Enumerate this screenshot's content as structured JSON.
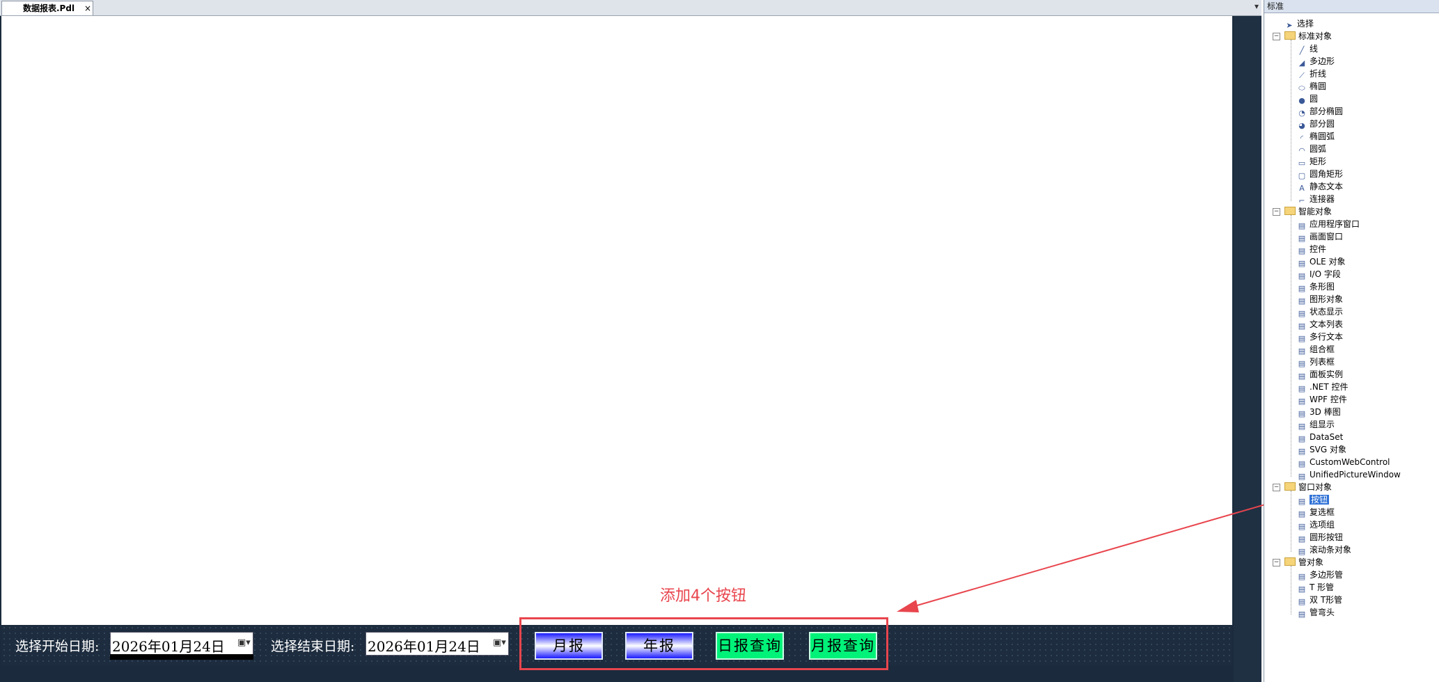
{
  "editor": {
    "tab": {
      "label": "数据报表.Pdl",
      "close": "×"
    },
    "tab_dropdown": "▾"
  },
  "controls": {
    "start_label": "选择开始日期:",
    "start_value": "2026年01月24日",
    "end_label": "选择结束日期:",
    "end_value": "2026年01月24日",
    "buttons": [
      {
        "label": "月报"
      },
      {
        "label": "年报"
      },
      {
        "label": "日报查询"
      },
      {
        "label": "月报查询"
      }
    ]
  },
  "annotation": {
    "text": "添加4个按钮",
    "color": "#e8454d"
  },
  "panel": {
    "title": "标准",
    "select": "选择",
    "groups": [
      {
        "name": "标准对象",
        "items": [
          "线",
          "多边形",
          "折线",
          "椭圆",
          "圆",
          "部分椭圆",
          "部分圆",
          "椭圆弧",
          "圆弧",
          "矩形",
          "圆角矩形",
          "静态文本",
          "连接器"
        ]
      },
      {
        "name": "智能对象",
        "items": [
          "应用程序窗口",
          "画面窗口",
          "控件",
          "OLE 对象",
          "I/O 字段",
          "条形图",
          "图形对象",
          "状态显示",
          "文本列表",
          "多行文本",
          "组合框",
          "列表框",
          "面板实例",
          ".NET 控件",
          "WPF 控件",
          "3D 棒图",
          "组显示",
          "DataSet",
          "SVG 对象",
          "CustomWebControl",
          "UnifiedPictureWindow"
        ]
      },
      {
        "name": "窗口对象",
        "items": [
          "按钮",
          "复选框",
          "选项组",
          "圆形按钮",
          "滚动条对象"
        ]
      },
      {
        "name": "管对象",
        "items": [
          "多边形管",
          "T 形管",
          "双 T形管",
          "管弯头"
        ]
      }
    ]
  }
}
